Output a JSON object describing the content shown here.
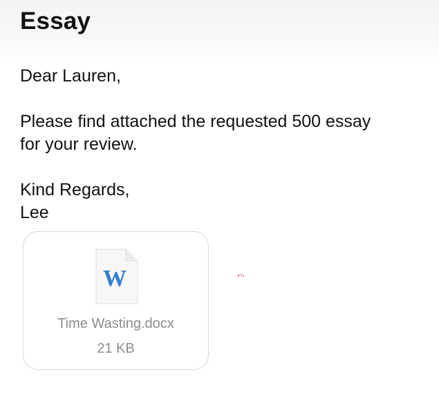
{
  "header": {
    "title": "Essay"
  },
  "email": {
    "greeting": "Dear Lauren,",
    "message_line_1": "Please find attached the requested 500 essay",
    "message_line_2": "for your review.",
    "signoff": "Kind Regards,",
    "signature": "Lee"
  },
  "attachment": {
    "icon": "word-document-icon",
    "icon_letter": "W",
    "filename": "Time Wasting.docx",
    "size": "21 KB"
  },
  "colors": {
    "text": "#111111",
    "secondary_text": "#8c8c8c",
    "card_border": "#d9d9d9",
    "word_blue": "#2f7fd1",
    "header_bg": "#f5f5f5"
  }
}
